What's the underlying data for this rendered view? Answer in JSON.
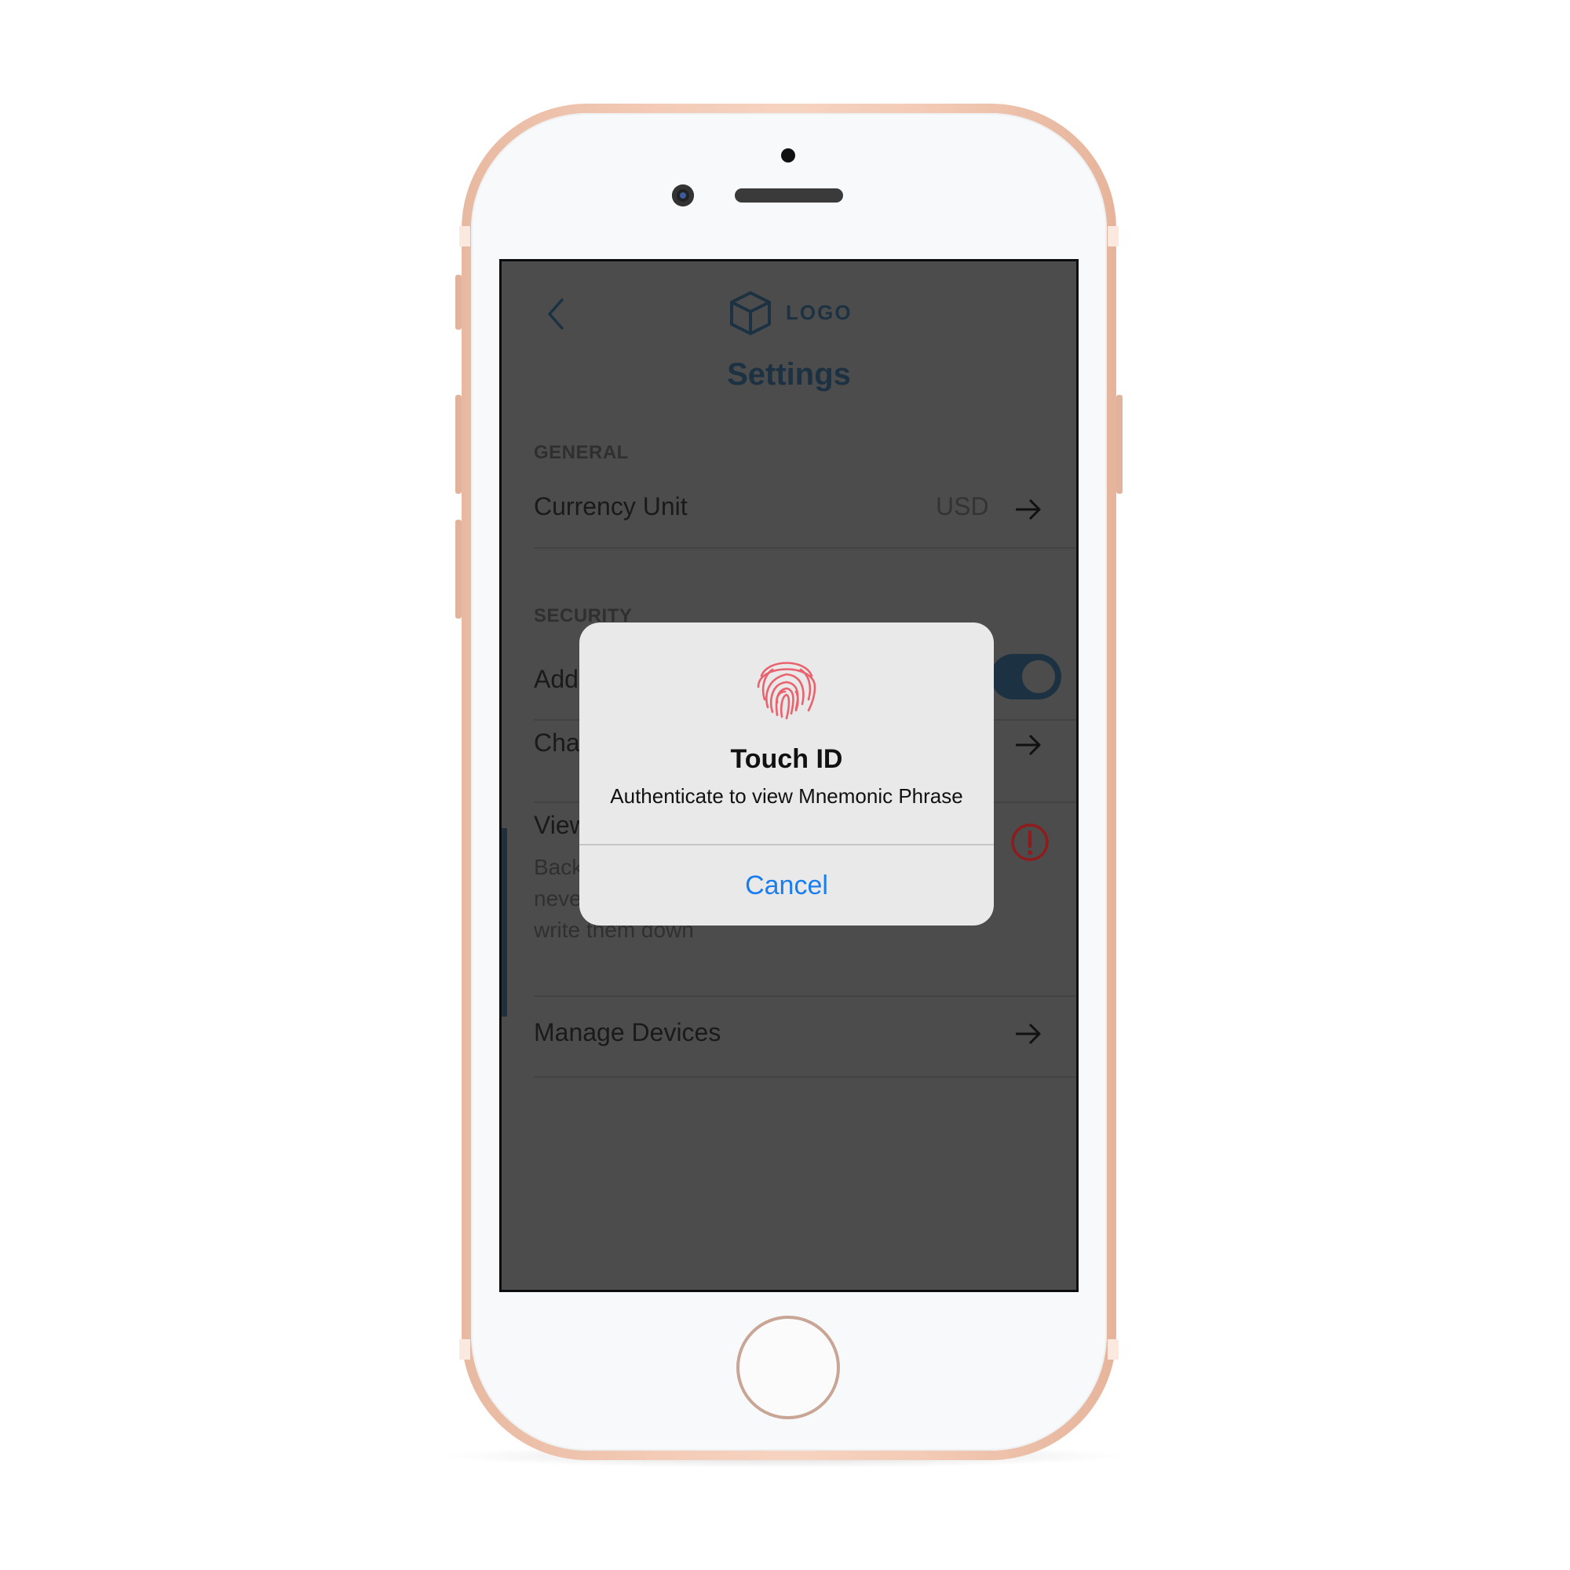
{
  "header": {
    "logo_text": "LOGO",
    "title": "Settings"
  },
  "general": {
    "section_label": "GENERAL",
    "currency": {
      "label": "Currency Unit",
      "value": "USD"
    }
  },
  "security": {
    "section_label": "SECURITY",
    "touch_id_label": "Add",
    "touch_id_enabled": true,
    "change_label": "Char",
    "view_label": "View",
    "view_desc_lines": [
      "Back",
      "never",
      "write them down"
    ],
    "manage_devices_label": "Manage Devices"
  },
  "modal": {
    "title": "Touch ID",
    "message": "Authenticate to view Mnemonic Phrase",
    "cancel_label": "Cancel"
  },
  "colors": {
    "accent": "#1c3242",
    "overlay": "#4c4c4c",
    "ios_blue": "#1a7ef0",
    "fingerprint": "#e9626e",
    "warning": "#8e1c1c",
    "phone_body": "#f3cbb6"
  },
  "icons": {
    "back": "chevron-left-icon",
    "logo": "cube-icon",
    "arrow": "arrow-right-icon",
    "warning": "exclamation-circle-icon",
    "fingerprint": "fingerprint-icon"
  }
}
